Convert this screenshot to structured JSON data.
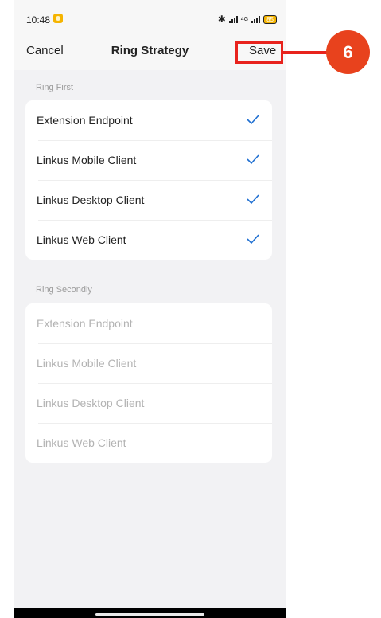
{
  "status_bar": {
    "time": "10:48",
    "network": "4G",
    "battery": "85"
  },
  "header": {
    "cancel_label": "Cancel",
    "title": "Ring Strategy",
    "save_label": "Save"
  },
  "ring_first": {
    "label": "Ring First",
    "items": [
      {
        "label": "Extension Endpoint",
        "checked": true
      },
      {
        "label": "Linkus Mobile Client",
        "checked": true
      },
      {
        "label": "Linkus Desktop Client",
        "checked": true
      },
      {
        "label": "Linkus Web Client",
        "checked": true
      }
    ]
  },
  "ring_secondly": {
    "label": "Ring Secondly",
    "items": [
      {
        "label": "Extension Endpoint",
        "checked": false
      },
      {
        "label": "Linkus Mobile Client",
        "checked": false
      },
      {
        "label": "Linkus Desktop Client",
        "checked": false
      },
      {
        "label": "Linkus Web Client",
        "checked": false
      }
    ]
  },
  "annotation": {
    "step": "6",
    "color": "#e8231d"
  },
  "colors": {
    "check": "#1f6fd1",
    "background": "#f2f2f4"
  },
  "icons": [
    "bluetooth-icon",
    "signal-icon",
    "battery-icon",
    "notification-icon",
    "check-icon"
  ]
}
